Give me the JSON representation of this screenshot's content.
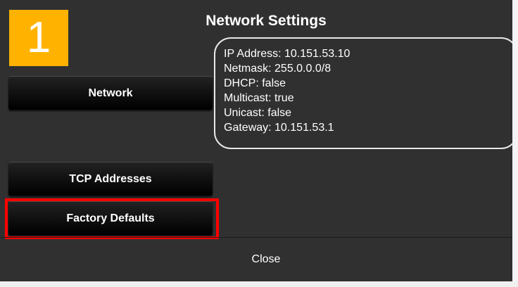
{
  "dialog": {
    "title": "Network Settings"
  },
  "step_badge": {
    "label": "1",
    "color": "#ffb300"
  },
  "buttons": {
    "network": "Network",
    "tcp_addresses": "TCP Addresses",
    "factory_defaults": "Factory Defaults",
    "close": "Close"
  },
  "highlight": {
    "color": "#ff0000",
    "target": "Factory Defaults"
  },
  "network_info": {
    "lines": [
      "IP Address: 10.151.53.10",
      "Netmask: 255.0.0.0/8",
      "DHCP: false",
      "Multicast: true",
      "Unicast: false",
      "Gateway: 10.151.53.1"
    ]
  }
}
